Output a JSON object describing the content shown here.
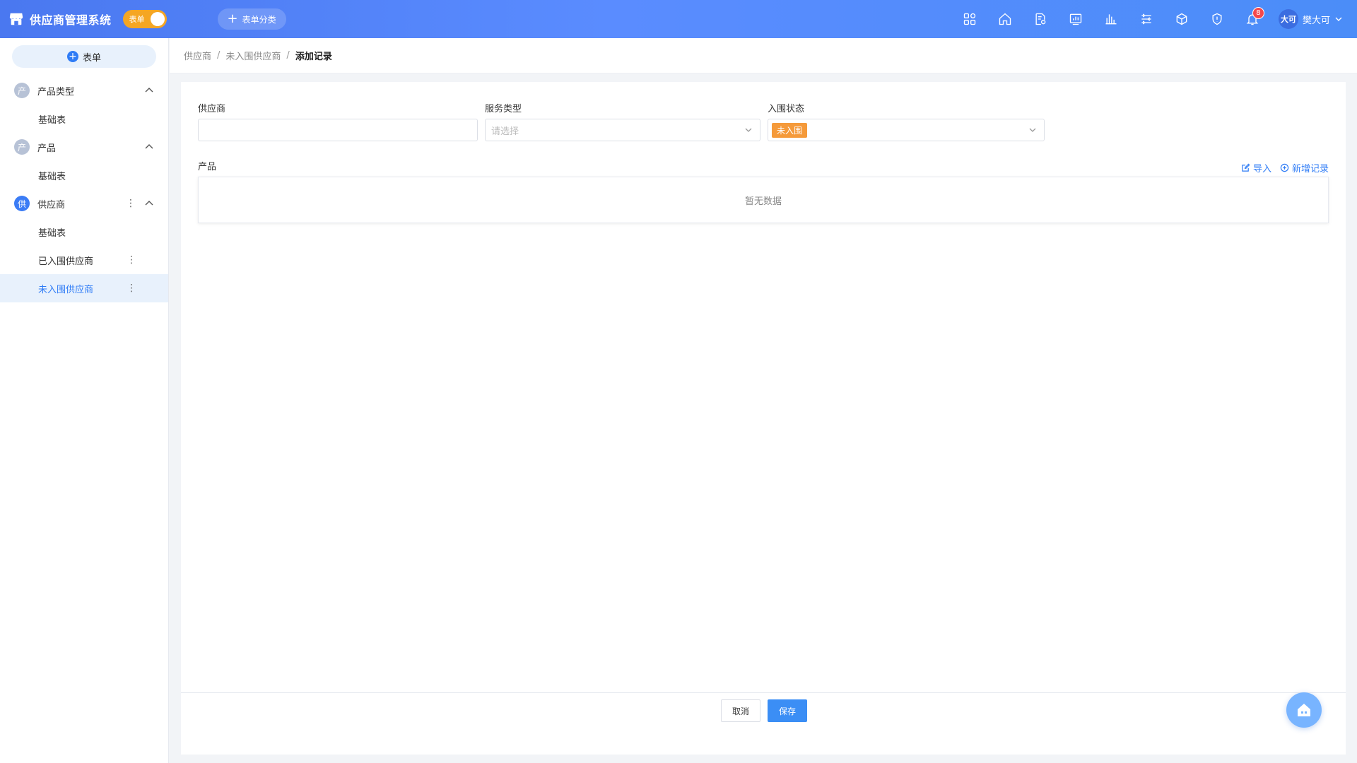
{
  "header": {
    "app_title": "供应商管理系统",
    "mode_toggle_label": "表单",
    "category_button": "表单分类",
    "notification_count": "8",
    "user_avatar_text": "大可",
    "user_name": "樊大可",
    "icons": [
      "apps-icon",
      "home-icon",
      "file-settings-icon",
      "dashboard-icon",
      "chart-icon",
      "database-icon",
      "cube-icon",
      "shield-icon",
      "bell-icon"
    ]
  },
  "sidebar": {
    "add_button": "表单",
    "groups": [
      {
        "icon_text": "产",
        "label": "产品类型",
        "items": [
          {
            "label": "基础表"
          }
        ]
      },
      {
        "icon_text": "产",
        "label": "产品",
        "items": [
          {
            "label": "基础表"
          }
        ]
      },
      {
        "icon_text": "供",
        "label": "供应商",
        "items": [
          {
            "label": "基础表"
          },
          {
            "label": "已入围供应商"
          },
          {
            "label": "未入围供应商"
          }
        ]
      }
    ]
  },
  "breadcrumb": {
    "items": [
      "供应商",
      "未入围供应商"
    ],
    "current": "添加记录",
    "separator": "/"
  },
  "form": {
    "supplier_label": "供应商",
    "supplier_value": "",
    "service_type_label": "服务类型",
    "service_type_placeholder": "请选择",
    "status_label": "入围状态",
    "status_tag": "未入围",
    "products_label": "产品",
    "import_label": "导入",
    "add_record_label": "新增记录",
    "empty_text": "暂无数据",
    "cancel_label": "取消",
    "save_label": "保存"
  },
  "colors": {
    "header_start": "#4a78f0",
    "accent": "#2f7cf6",
    "tag_orange": "#f59a3a",
    "toggle_orange": "#f5a623"
  }
}
